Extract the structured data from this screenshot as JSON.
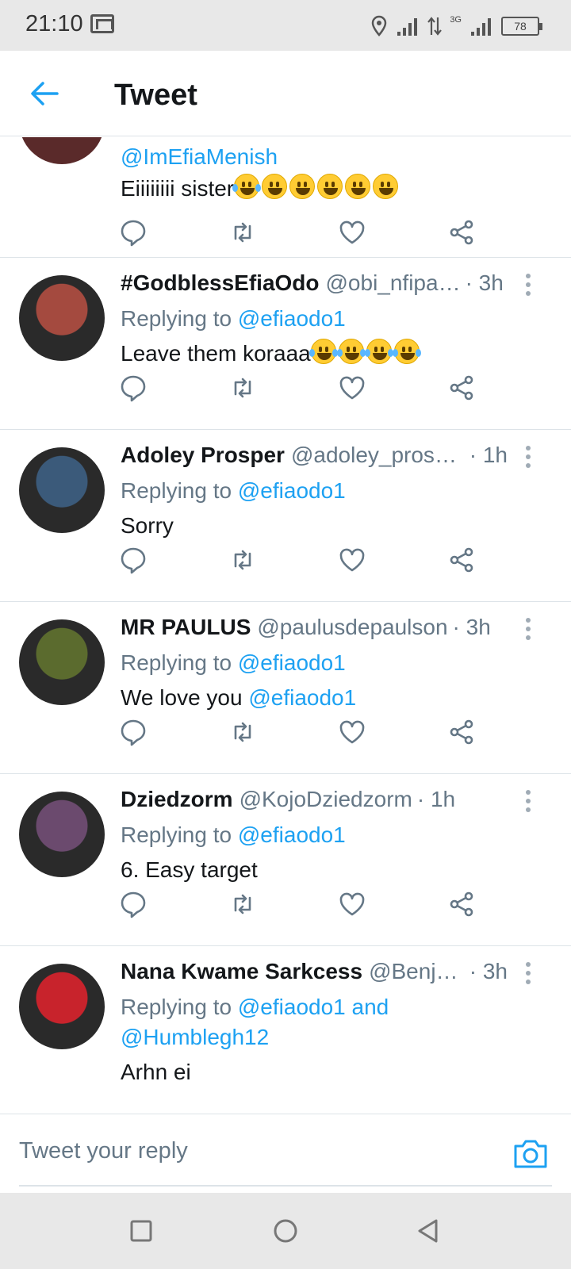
{
  "status_bar": {
    "time": "21:10",
    "battery": "78",
    "network": "3G"
  },
  "header": {
    "title": "Tweet"
  },
  "top_partial": {
    "reply_to": "@ImEfiaMenish",
    "text": "Eiiiiiiii sister",
    "emojis": [
      "joy",
      "grin",
      "grin",
      "grin",
      "grin",
      "grin"
    ]
  },
  "tweets": [
    {
      "name": "#GodblessEfiaOdo",
      "handle": "@obi_nfipa…",
      "time": "· 3h",
      "replying_label": "Replying to",
      "reply_to": "@efiaodo1",
      "text": "Leave them koraaa",
      "emojis": [
        "joy",
        "joy",
        "joy",
        "joy"
      ],
      "avatar_color": "#a44a3f"
    },
    {
      "name": "Adoley Prosper",
      "handle": "@adoley_prosp…",
      "time": "· 1h",
      "replying_label": "Replying to",
      "reply_to": "@efiaodo1",
      "text": "Sorry",
      "emojis": [],
      "avatar_color": "#3b5a7a"
    },
    {
      "name": "MR PAULUS",
      "handle": "@paulusdepaulson",
      "time": "· 3h",
      "replying_label": "Replying to",
      "reply_to": "@efiaodo1",
      "text": "We love you ",
      "text_mention": "@efiaodo1",
      "emojis": [],
      "avatar_color": "#5b6b2e"
    },
    {
      "name": "Dziedzorm",
      "handle": "@KojoDziedzorm",
      "time": "· 1h",
      "replying_label": "Replying to",
      "reply_to": "@efiaodo1",
      "text": "6. Easy target",
      "emojis": [],
      "avatar_color": "#6b4a6e"
    },
    {
      "name": "Nana Kwame Sarkcess",
      "handle": "@Benja…",
      "time": "· 3h",
      "replying_label": "Replying to",
      "reply_to": "@efiaodo1 and",
      "reply_to_2": "@Humblegh12",
      "text": "Arhn ei",
      "emojis": [],
      "avatar_color": "#c8232c"
    }
  ],
  "composer": {
    "placeholder": "Tweet your reply"
  },
  "colors": {
    "accent": "#1da1f2",
    "text": "#14171a",
    "muted": "#657786",
    "divider": "#dde3e8"
  }
}
